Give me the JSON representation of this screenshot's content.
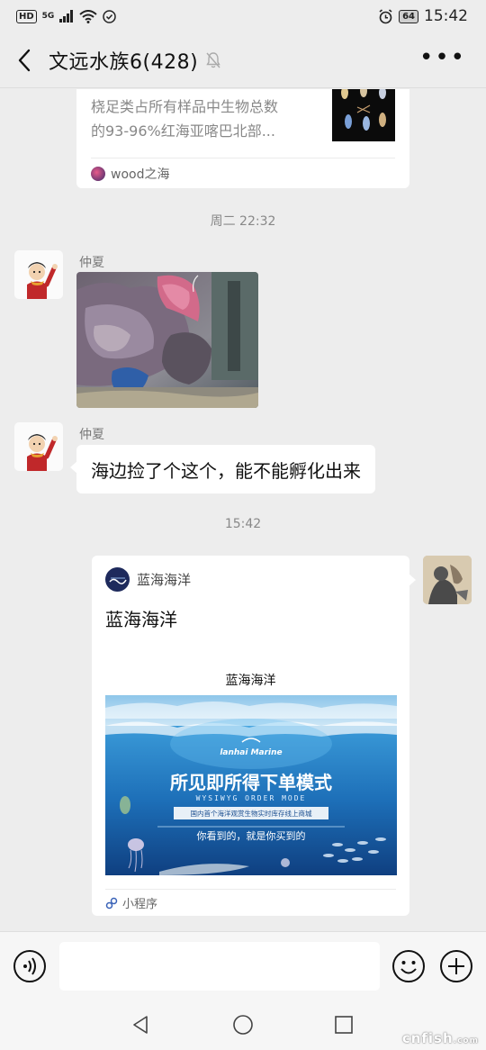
{
  "status_bar": {
    "hd": "HD",
    "net": "5G",
    "battery": "64",
    "time": "15:42"
  },
  "header": {
    "title": "文远水族6(428)"
  },
  "messages": {
    "shared_article": {
      "desc_line1": "桡足类占所有样品中生物总数",
      "desc_line2": "的93-96%红海亚喀巴北部...",
      "source": "wood之海"
    },
    "timestamp_1": "周二 22:32",
    "msg_photo": {
      "sender": "仲夏"
    },
    "msg_text": {
      "sender": "仲夏",
      "text": "海边捡了个这个，能不能孵化出来"
    },
    "timestamp_2": "15:42",
    "mini_program": {
      "app_name": "蓝海海洋",
      "title": "蓝海海洋",
      "image_caption": "蓝海海洋",
      "banner_brand": "lanhai Marine",
      "banner_headline": "所见即所得下单模式",
      "banner_en": "WYSIWYG ORDER MODE",
      "banner_sub": "国内首个海洋观赏生物实时库存线上商城",
      "banner_slogan": "你看到的，就是你买到的",
      "footer": "小程序"
    }
  },
  "input_bar": {
    "placeholder": ""
  },
  "watermark": {
    "text": "cnfish",
    "suffix": ".com"
  },
  "colors": {
    "background": "#ededed",
    "bubble": "#ffffff",
    "muted_text": "#888888",
    "banner_sea": "#1d6fb8"
  }
}
